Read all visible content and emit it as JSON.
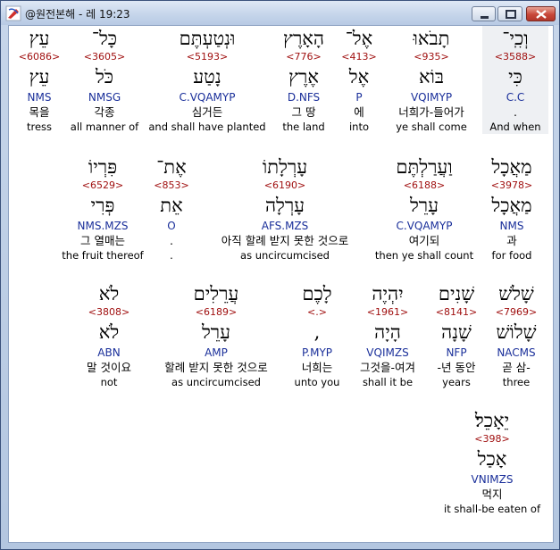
{
  "window": {
    "title": "@원전본해 - 레 19:23",
    "buttons": {
      "minimize": "minimize",
      "maximize": "maximize",
      "close": "close"
    }
  },
  "colors": {
    "strong": "#a01010",
    "morph": "#1a2f9a",
    "selected_bg": "#eef0f3"
  },
  "rows": [
    [
      {
        "heb": "וְכִֽי־",
        "strong": "<3588>",
        "lemma": "כִּי",
        "morph": "C.C",
        "kor": ".",
        "eng": "And when"
      },
      {
        "heb": "תָבֹאוּ",
        "strong": "<935>",
        "lemma": "בּוֹא",
        "morph": "VQIMYP",
        "kor": "너희가-들어가",
        "eng": "ye shall come"
      },
      {
        "heb": "אֶל־",
        "strong": "<413>",
        "lemma": "אֶל",
        "morph": "P",
        "kor": "에",
        "eng": "into"
      },
      {
        "heb": "הָאָרֶץ",
        "strong": "<776>",
        "lemma": "אֶרֶץ",
        "morph": "D.NFS",
        "kor": "그 땅",
        "eng": "the land"
      },
      {
        "heb": "וּנְטַעְתֶּם",
        "strong": "<5193>",
        "lemma": "נָטַע",
        "morph": "C.VQAMYP",
        "kor": "심거든",
        "eng": "and shall have planted"
      },
      {
        "heb": "כָּל־",
        "strong": "<3605>",
        "lemma": "כֹּל",
        "morph": "NMSG",
        "kor": "각종",
        "eng": "all manner of"
      },
      {
        "heb": "עֵץ",
        "strong": "<6086>",
        "lemma": "עֵץ",
        "morph": "NMS",
        "kor": "목을",
        "eng": "tress"
      }
    ],
    [
      {
        "heb": "מַאֲכָל",
        "strong": "<3978>",
        "lemma": "מַאֲכָל",
        "morph": "NMS",
        "kor": "과",
        "eng": "for food"
      },
      {
        "heb": "וַעֲרַלְתֶּם",
        "strong": "<6188>",
        "lemma": "עָרֵל",
        "morph": "C.VQAMYP",
        "kor": "여기되",
        "eng": "then ye shall count"
      },
      {
        "heb": "עָרְלָתוֹ",
        "strong": "<6190>",
        "lemma": "עָרְלָה",
        "morph": "AFS.MZS",
        "kor": "아직 할례 받지 못한 것으로",
        "eng": "as uncircumcised"
      },
      {
        "heb": "אֶת־",
        "strong": "<853>",
        "lemma": "אֵת",
        "morph": "O",
        "kor": ".",
        "eng": "."
      },
      {
        "heb": "פִּרְיוֹ",
        "strong": "<6529>",
        "lemma": "פְּרִי",
        "morph": "NMS.MZS",
        "kor": "그 열매는",
        "eng": "the fruit thereof"
      }
    ],
    [
      {
        "heb": "שָׁלֹשׁ",
        "strong": "<7969>",
        "lemma": "שָׁלוֹשׁ",
        "morph": "NACMS",
        "kor": "곧 삼-",
        "eng": "three"
      },
      {
        "heb": "שָׁנִים",
        "strong": "<8141>",
        "lemma": "שָׁנָה",
        "morph": "NFP",
        "kor": "-년 동안",
        "eng": "years"
      },
      {
        "heb": "יִהְיֶה",
        "strong": "<1961>",
        "lemma": "הָיָה",
        "morph": "VQIMZS",
        "kor": "그것을-여겨",
        "eng": "shall it be"
      },
      {
        "heb": "לָכֶם",
        "strong": "<.>",
        "lemma": ",",
        "morph": "P.MYP",
        "kor": "너희는",
        "eng": "unto you"
      },
      {
        "heb": "עֲרֵלִים",
        "strong": "<6189>",
        "lemma": "עָרֵל",
        "morph": "AMP",
        "kor": "할례 받지 못한 것으로",
        "eng": "as uncircumcised"
      },
      {
        "heb": "לֹא",
        "strong": "<3808>",
        "lemma": "לֹא",
        "morph": "ABN",
        "kor": "말 것이요",
        "eng": "not"
      }
    ],
    [
      {
        "heb": "יֵאָכֵל׃",
        "strong": "<398>",
        "lemma": "אָכַל",
        "morph": "VNIMZS",
        "kor": "먹지",
        "eng": "it shall-be eaten of"
      }
    ]
  ]
}
